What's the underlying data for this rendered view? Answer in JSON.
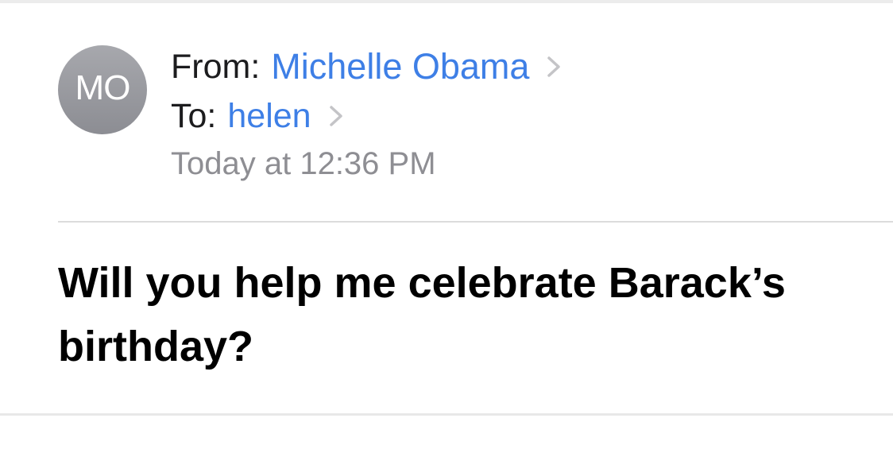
{
  "sender": {
    "initials": "MO",
    "from_label": "From:",
    "name": "Michelle Obama"
  },
  "recipient": {
    "to_label": "To:",
    "name": "helen"
  },
  "date": "Today at 12:36 PM",
  "subject": "Will you help me celebrate Barack’s birthday?",
  "colors": {
    "link": "#3e7fe6",
    "meta_gray": "#8e8e93",
    "avatar_gray": "#9a9ba0"
  },
  "icons": {
    "sender_disclosure": "chevron-right-icon",
    "recipient_disclosure": "chevron-right-icon"
  }
}
